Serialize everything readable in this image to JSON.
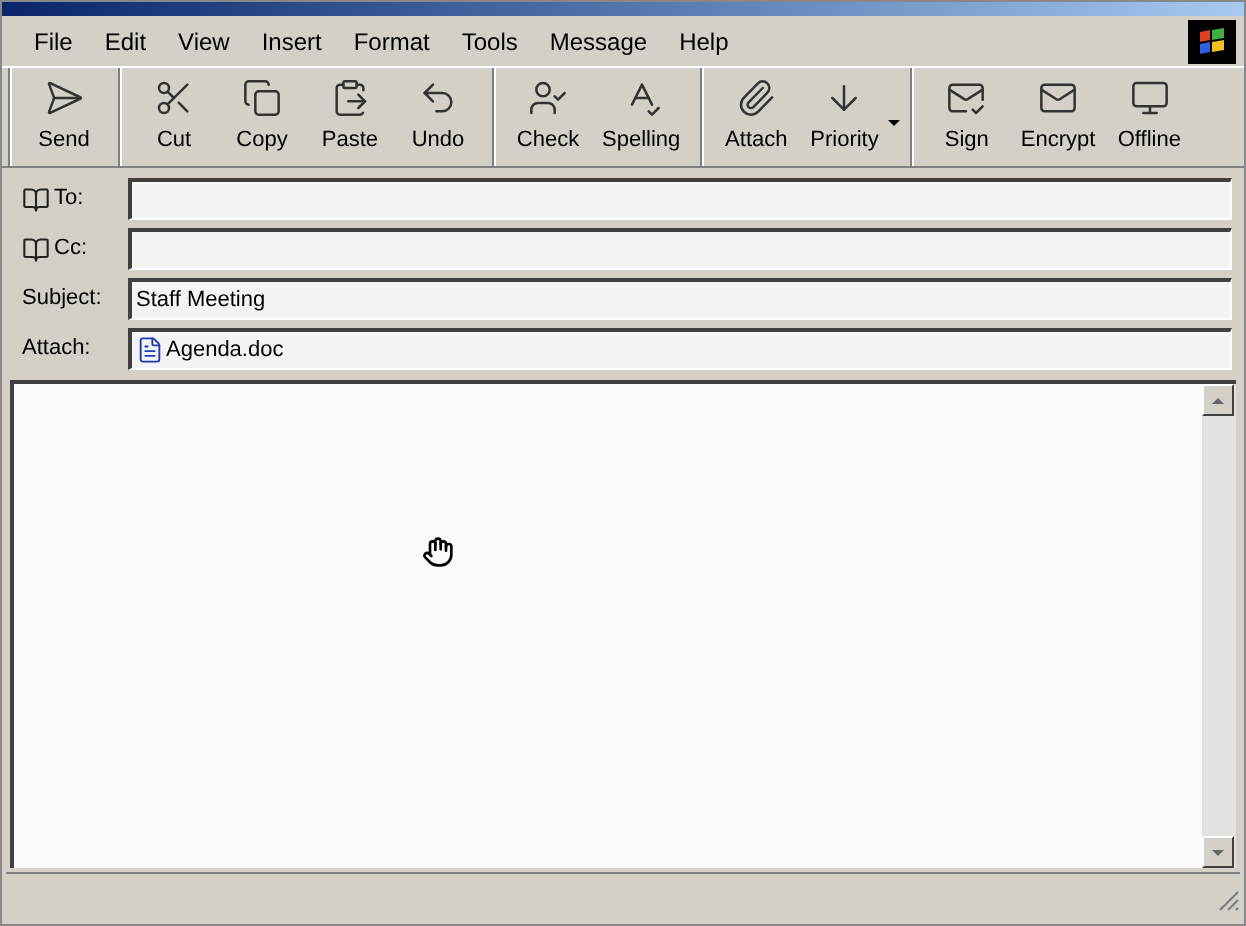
{
  "menu": [
    "File",
    "Edit",
    "View",
    "Insert",
    "Format",
    "Tools",
    "Message",
    "Help"
  ],
  "toolbar": [
    [
      {
        "label": "Send",
        "kind": "send"
      }
    ],
    [
      {
        "label": "Cut",
        "kind": "cut"
      },
      {
        "label": "Copy",
        "kind": "copy"
      },
      {
        "label": "Paste",
        "kind": "paste"
      },
      {
        "label": "Undo",
        "kind": "undo"
      }
    ],
    [
      {
        "label": "Check",
        "kind": "check"
      },
      {
        "label": "Spelling",
        "kind": "spelling"
      }
    ],
    [
      {
        "label": "Attach",
        "kind": "attach"
      },
      {
        "label": "Priority",
        "kind": "priority",
        "dropdown": true
      }
    ],
    [
      {
        "label": "Sign",
        "kind": "sign"
      },
      {
        "label": "Encrypt",
        "kind": "encrypt"
      },
      {
        "label": "Offline",
        "kind": "offline"
      }
    ]
  ],
  "fields": [
    {
      "label": "To:",
      "kind": "address"
    },
    {
      "label": "Cc:",
      "kind": "address"
    },
    {
      "label": "Subject:",
      "kind": "text",
      "value": "Staff Meeting"
    },
    {
      "label": "Attach:",
      "kind": "attachment",
      "value": "Agenda.doc"
    }
  ]
}
